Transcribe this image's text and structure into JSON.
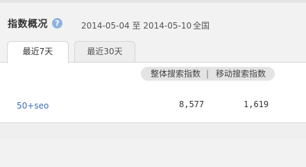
{
  "header": {
    "title": "指数概况",
    "help_icon": "?",
    "date_range": "2014-05-04 至 2014-05-10",
    "region": "全国"
  },
  "tabs": [
    {
      "label": "最近7天",
      "active": true
    },
    {
      "label": "最近30天",
      "active": false
    }
  ],
  "toggle": {
    "option_a": "整体搜索指数",
    "separator": "|",
    "option_b": "移动搜索指数"
  },
  "rows": [
    {
      "keyword": "50+seo",
      "overall_index": "8,577",
      "mobile_index": "1,619"
    }
  ],
  "colors": {
    "link": "#3a6eb5",
    "help_icon_bg": "#8eb3de",
    "pill_bg": "#e4e4e4"
  }
}
